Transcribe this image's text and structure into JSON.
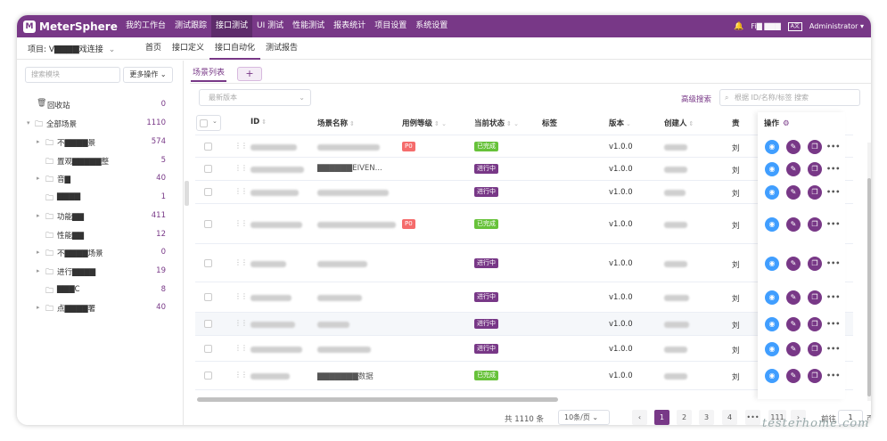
{
  "app": {
    "logo_text": "MeterSphere",
    "logo_mark": "M"
  },
  "topnav": [
    "我的工作台",
    "测试跟踪",
    "接口测试",
    "UI 测试",
    "性能测试",
    "报表统计",
    "项目设置",
    "系统设置"
  ],
  "topnav_active": 2,
  "topright": {
    "workspace": "Fi▇ ▇▇▇",
    "lang": "A文",
    "user": "Administrator ▾"
  },
  "project": {
    "label": "项目: V▇▇▇▇戏连接",
    "caret": "⌄"
  },
  "subnav": [
    "首页",
    "接口定义",
    "接口自动化",
    "测试报告"
  ],
  "subnav_active": 2,
  "sidebar": {
    "search_placeholder": "搜索模块",
    "more_ops": "更多操作 ⌄",
    "recycle": {
      "label": "回收站",
      "count": "0"
    },
    "root": {
      "label": "全部场景",
      "count": "1110"
    },
    "items": [
      {
        "label": "不▇▇▇▇景",
        "count": "574",
        "expand": true
      },
      {
        "label": "置观▇▇▇▇▇整",
        "count": "5",
        "expand": false
      },
      {
        "label": "音▇",
        "count": "40",
        "expand": true
      },
      {
        "label": "▇▇▇▇",
        "count": "1",
        "expand": false
      },
      {
        "label": "功能▇▇",
        "count": "411",
        "expand": true
      },
      {
        "label": "性能▇▇",
        "count": "12",
        "expand": false
      },
      {
        "label": "不▇▇▇▇场景",
        "count": "0",
        "expand": true
      },
      {
        "label": "进行▇▇▇▇",
        "count": "19",
        "expand": true
      },
      {
        "label": "▇▇▇C",
        "count": "8",
        "expand": false
      },
      {
        "label": "点▇▇▇▇署",
        "count": "40",
        "expand": true
      }
    ]
  },
  "main": {
    "tab_label": "场景列表",
    "tab_add": "+",
    "version_placeholder": "最新版本",
    "adv_search": "高级搜索",
    "search_placeholder": "根据 ID/名称/标签 搜索",
    "headers": {
      "id": "ID",
      "name": "场景名称",
      "level": "用例等级",
      "status": "当前状态",
      "tags": "标签",
      "version": "版本",
      "creator": "创建人",
      "owner": "责",
      "ops": "操作"
    },
    "rows": [
      {
        "id_w": 52,
        "name_w": 70,
        "name_txt": "",
        "level": "P0",
        "status": "已完成",
        "status_type": "done",
        "version": "v1.0.0",
        "creator_w": 26,
        "owner": "刘"
      },
      {
        "id_w": 60,
        "name_w": 20,
        "name_txt": "▇▇▇▇▇▇EIVEN...",
        "level": "",
        "status": "进行中",
        "status_type": "prog",
        "version": "v1.0.0",
        "creator_w": 26,
        "owner": "刘"
      },
      {
        "id_w": 54,
        "name_w": 80,
        "name_txt": "",
        "level": "",
        "status": "进行中",
        "status_type": "prog",
        "version": "v1.0.0",
        "creator_w": 24,
        "owner": "刘"
      },
      {
        "id_w": 58,
        "name_w": 88,
        "name_txt": "",
        "level": "P0",
        "status": "已完成",
        "status_type": "done",
        "version": "v1.0.0",
        "creator_w": 26,
        "owner": "刘"
      },
      {
        "id_w": 40,
        "name_w": 56,
        "name_txt": "",
        "level": "",
        "status": "进行中",
        "status_type": "prog",
        "version": "v1.0.0",
        "creator_w": 26,
        "owner": "刘"
      },
      {
        "id_w": 46,
        "name_w": 50,
        "name_txt": "",
        "level": "",
        "status": "进行中",
        "status_type": "prog",
        "version": "v1.0.0",
        "creator_w": 28,
        "owner": "刘"
      },
      {
        "id_w": 50,
        "name_w": 36,
        "name_txt": "",
        "level": "",
        "status": "进行中",
        "status_type": "prog",
        "version": "v1.0.0",
        "creator_w": 28,
        "owner": "刘"
      },
      {
        "id_w": 58,
        "name_w": 60,
        "name_txt": "",
        "level": "",
        "status": "进行中",
        "status_type": "prog",
        "version": "v1.0.0",
        "creator_w": 26,
        "owner": "刘"
      },
      {
        "id_w": 44,
        "name_w": 24,
        "name_txt": "▇▇▇▇▇▇▇数据",
        "level": "",
        "status": "已完成",
        "status_type": "done",
        "version": "v1.0.0",
        "creator_w": 26,
        "owner": "刘"
      }
    ]
  },
  "ops_icons": {
    "run": "run-icon",
    "edit": "edit-icon",
    "copy": "copy-icon",
    "more": "more-icon"
  },
  "pager": {
    "total": "共 1110 条",
    "size": "10条/页 ⌄",
    "pages": [
      "‹",
      "1",
      "2",
      "3",
      "4",
      "•••",
      "111",
      "›"
    ],
    "goto": "前往",
    "current": "1",
    "page_unit": "页"
  },
  "watermark": "testerhome.com",
  "colors": {
    "brand": "#783887",
    "done": "#67c23a",
    "p0": "#f56c6c",
    "run": "#409eff"
  }
}
